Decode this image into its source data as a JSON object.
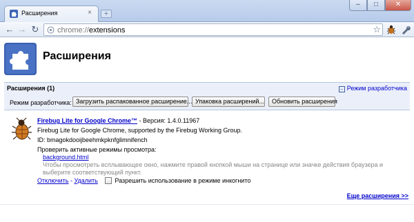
{
  "window": {
    "tab_title": "Расширения",
    "tab_close": "×",
    "new_tab": "+",
    "minimize": "–",
    "maximize": "□",
    "close": "✕"
  },
  "toolbar": {
    "back": "←",
    "forward": "→",
    "reload": "↻",
    "url_scheme": "chrome://",
    "url_path": "extensions",
    "star": "☆"
  },
  "page": {
    "title": "Расширения"
  },
  "extensions_panel": {
    "header": "Расширения (1)",
    "dev_mode_toggle": "Режим разработчика",
    "dev_mode_label": "Режим разработчика:",
    "buttons": {
      "load_unpacked": "Загрузить распакованное расширение...",
      "pack": "Упаковка расширений...",
      "update": "Обновить расширения"
    }
  },
  "extension": {
    "name": "Firebug Lite for Google Chrome™",
    "version_text": " - Версия: 1.4.0.11967",
    "description": "Firebug Lite for Google Chrome, supported by the Firebug Working Group.",
    "id_line": "ID: bmagokdooijbeehmkpknfglimnifench",
    "inspect_views_label": "Проверить активные режимы просмотра:",
    "view_link": "background.html",
    "hint": "Чтобы просмотреть всплывающее окно, нажмите правой кнопкой мыши на странице или значке действия браузера и выберите соответствующий пункт.",
    "disable": "Отключить",
    "separator": " - ",
    "remove": "Удалить",
    "incognito_label": "Разрешить использование в режиме инкогнито",
    "incognito_checked": false
  },
  "footer": {
    "more_extensions": "Еще расширения >>"
  },
  "colors": {
    "link": "#0000cc",
    "panel_bg": "#ebeff9",
    "frame": "#b7cbea"
  },
  "icons": [
    "puzzle-icon",
    "firebug-icon",
    "page-icon",
    "star-icon",
    "wrench-icon",
    "page-menu-icon"
  ]
}
